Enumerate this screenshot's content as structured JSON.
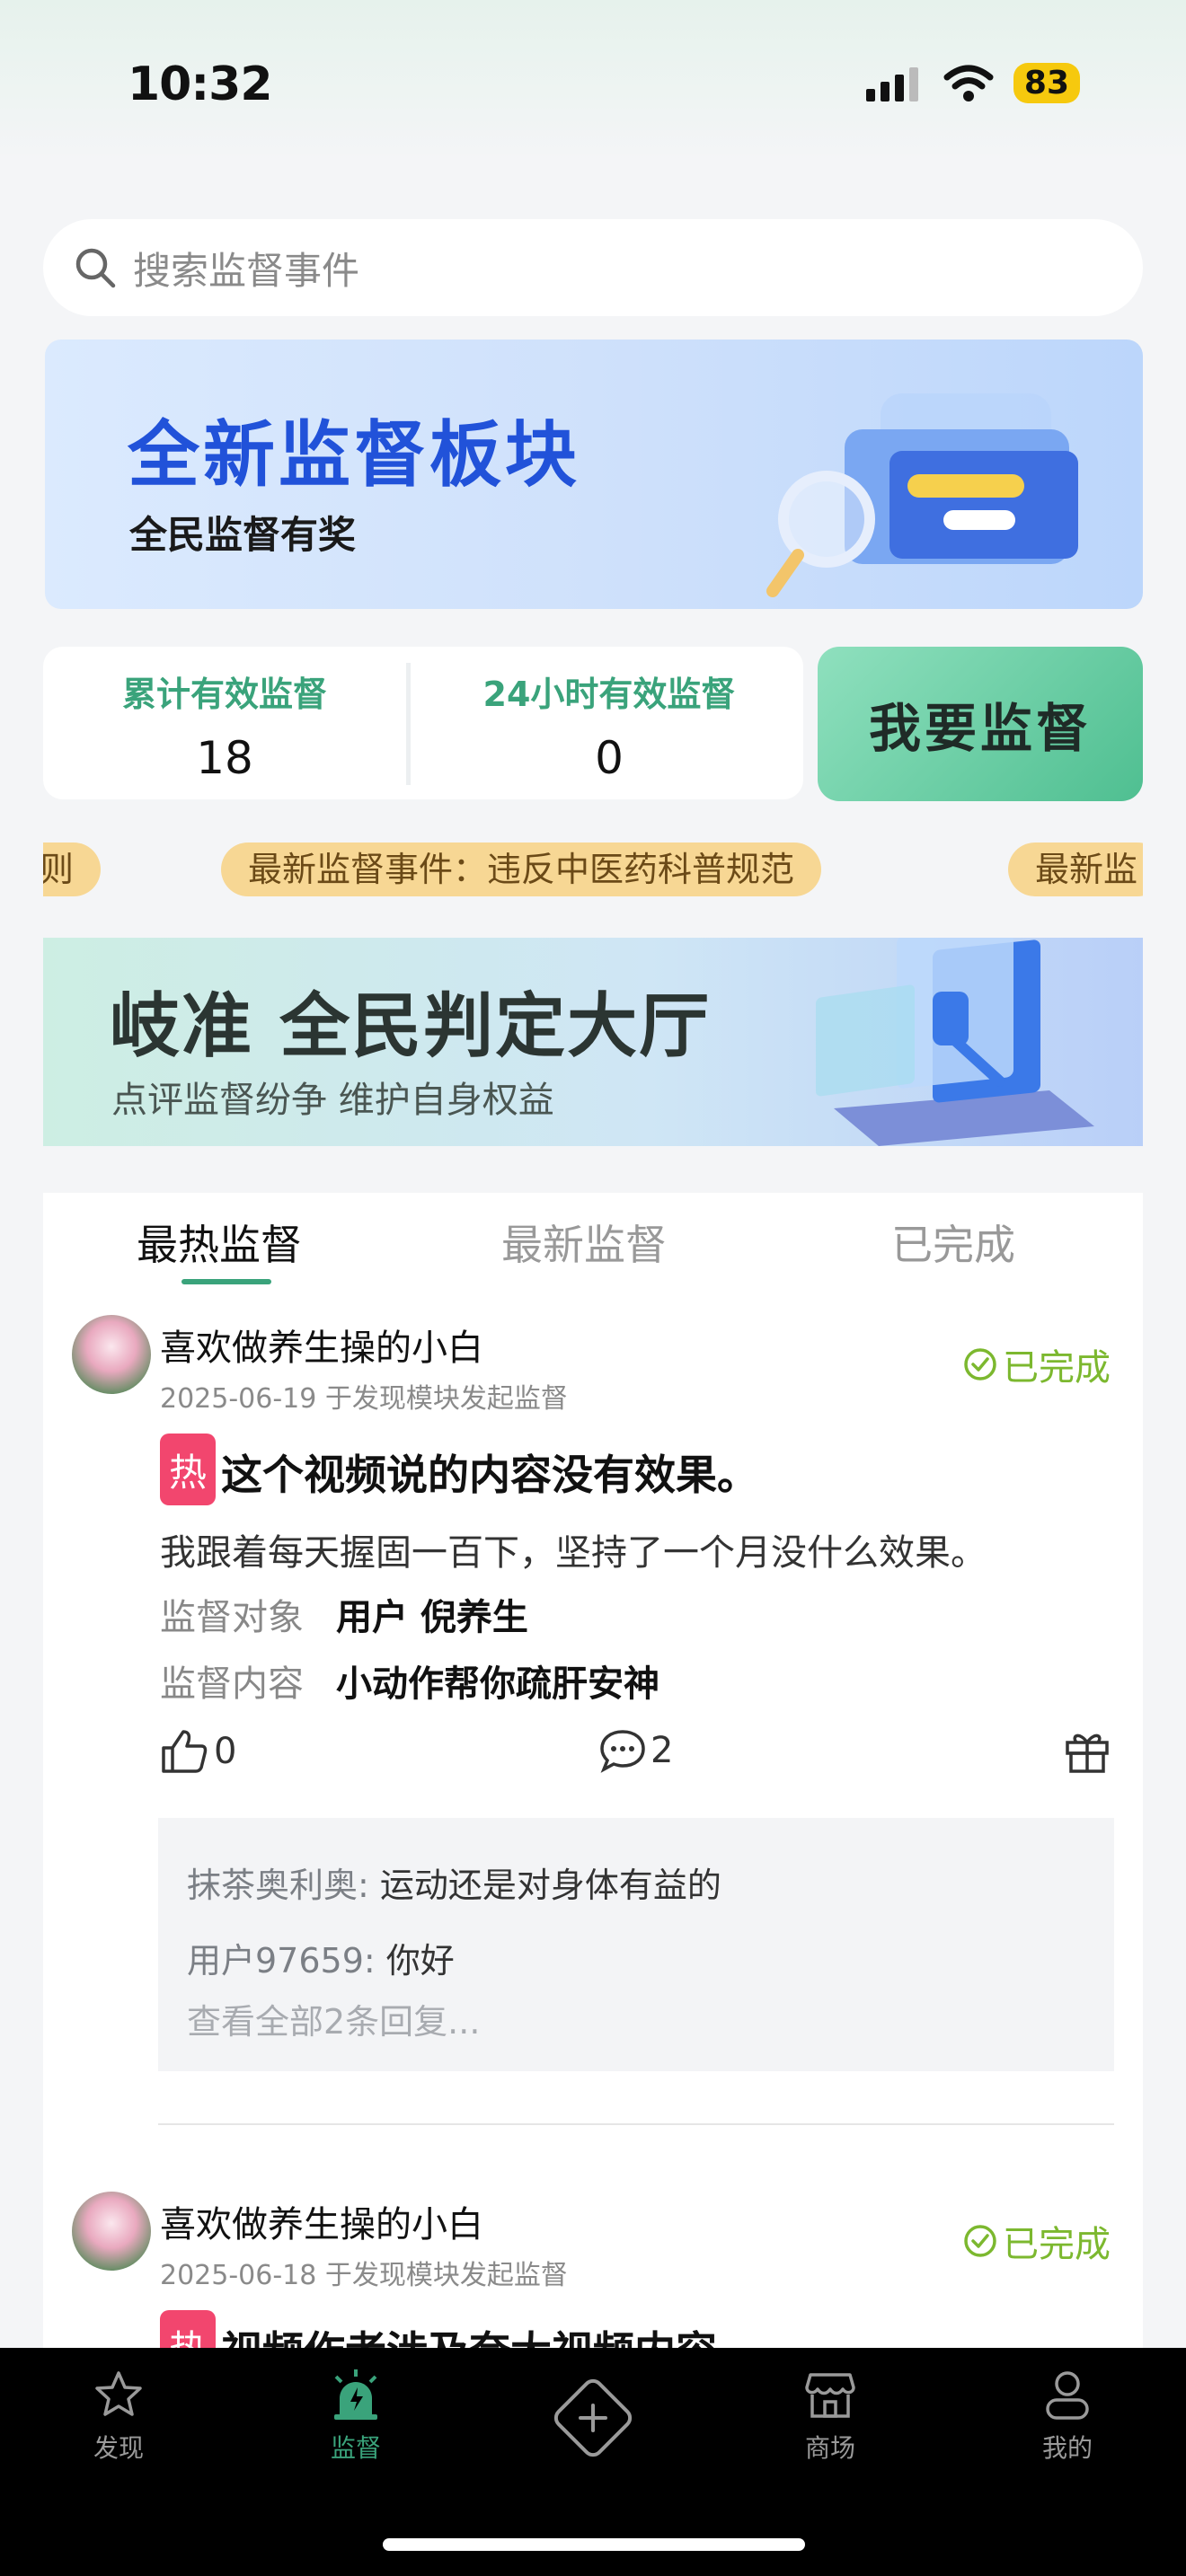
{
  "status_bar": {
    "time": "10:32",
    "battery": "83"
  },
  "search": {
    "placeholder": "搜索监督事件"
  },
  "banner_top": {
    "title": "全新监督板块",
    "subtitle": "全民监督有奖"
  },
  "stats": {
    "total_label": "累计有效监督",
    "total_value": "18",
    "day_label": "24小时有效监督",
    "day_value": "0",
    "cta": "我要监督"
  },
  "ticker": {
    "left_fragment": "则",
    "main": "最新监督事件：违反中医药科普规范",
    "right_fragment": "最新监"
  },
  "banner_judge": {
    "title": "岐准 全民判定大厅",
    "subtitle": "点评监督纷争 维护自身权益"
  },
  "tabs": [
    {
      "label": "最热监督"
    },
    {
      "label": "最新监督"
    },
    {
      "label": "已完成"
    }
  ],
  "posts": [
    {
      "user": "喜欢做养生操的小白",
      "meta": "2025-06-19 于发现模块发起监督",
      "status": "已完成",
      "hot_tag": "热",
      "title": "这个视频说的内容没有效果。",
      "desc": "我跟着每天握固一百下，坚持了一个月没什么效果。",
      "target_label": "监督对象",
      "target_value": "用户 倪养生",
      "content_label": "监督内容",
      "content_value": "小动作帮你疏肝安神",
      "likes": "0",
      "comments": "2",
      "replies": [
        {
          "who": "抹茶奥利奥:",
          "text": " 运动还是对身体有益的"
        },
        {
          "who": "用户97659:",
          "text": " 你好"
        }
      ],
      "more": "查看全部2条回复..."
    },
    {
      "user": "喜欢做养生操的小白",
      "meta": "2025-06-18 于发现模块发起监督",
      "status": "已完成",
      "hot_tag": "热",
      "title": "视频作者涉及夸大视频内容"
    }
  ],
  "nav": [
    {
      "label": "发现",
      "icon": "star-badge-icon"
    },
    {
      "label": "监督",
      "icon": "alarm-light-icon"
    },
    {
      "label": "",
      "icon": "plus-diamond-icon"
    },
    {
      "label": "商场",
      "icon": "store-icon"
    },
    {
      "label": "我的",
      "icon": "user-icon"
    }
  ],
  "colors": {
    "accent": "#3aa37b",
    "done": "#7cb82f",
    "hot": "#f2466e",
    "banner_title": "#2152d9"
  }
}
